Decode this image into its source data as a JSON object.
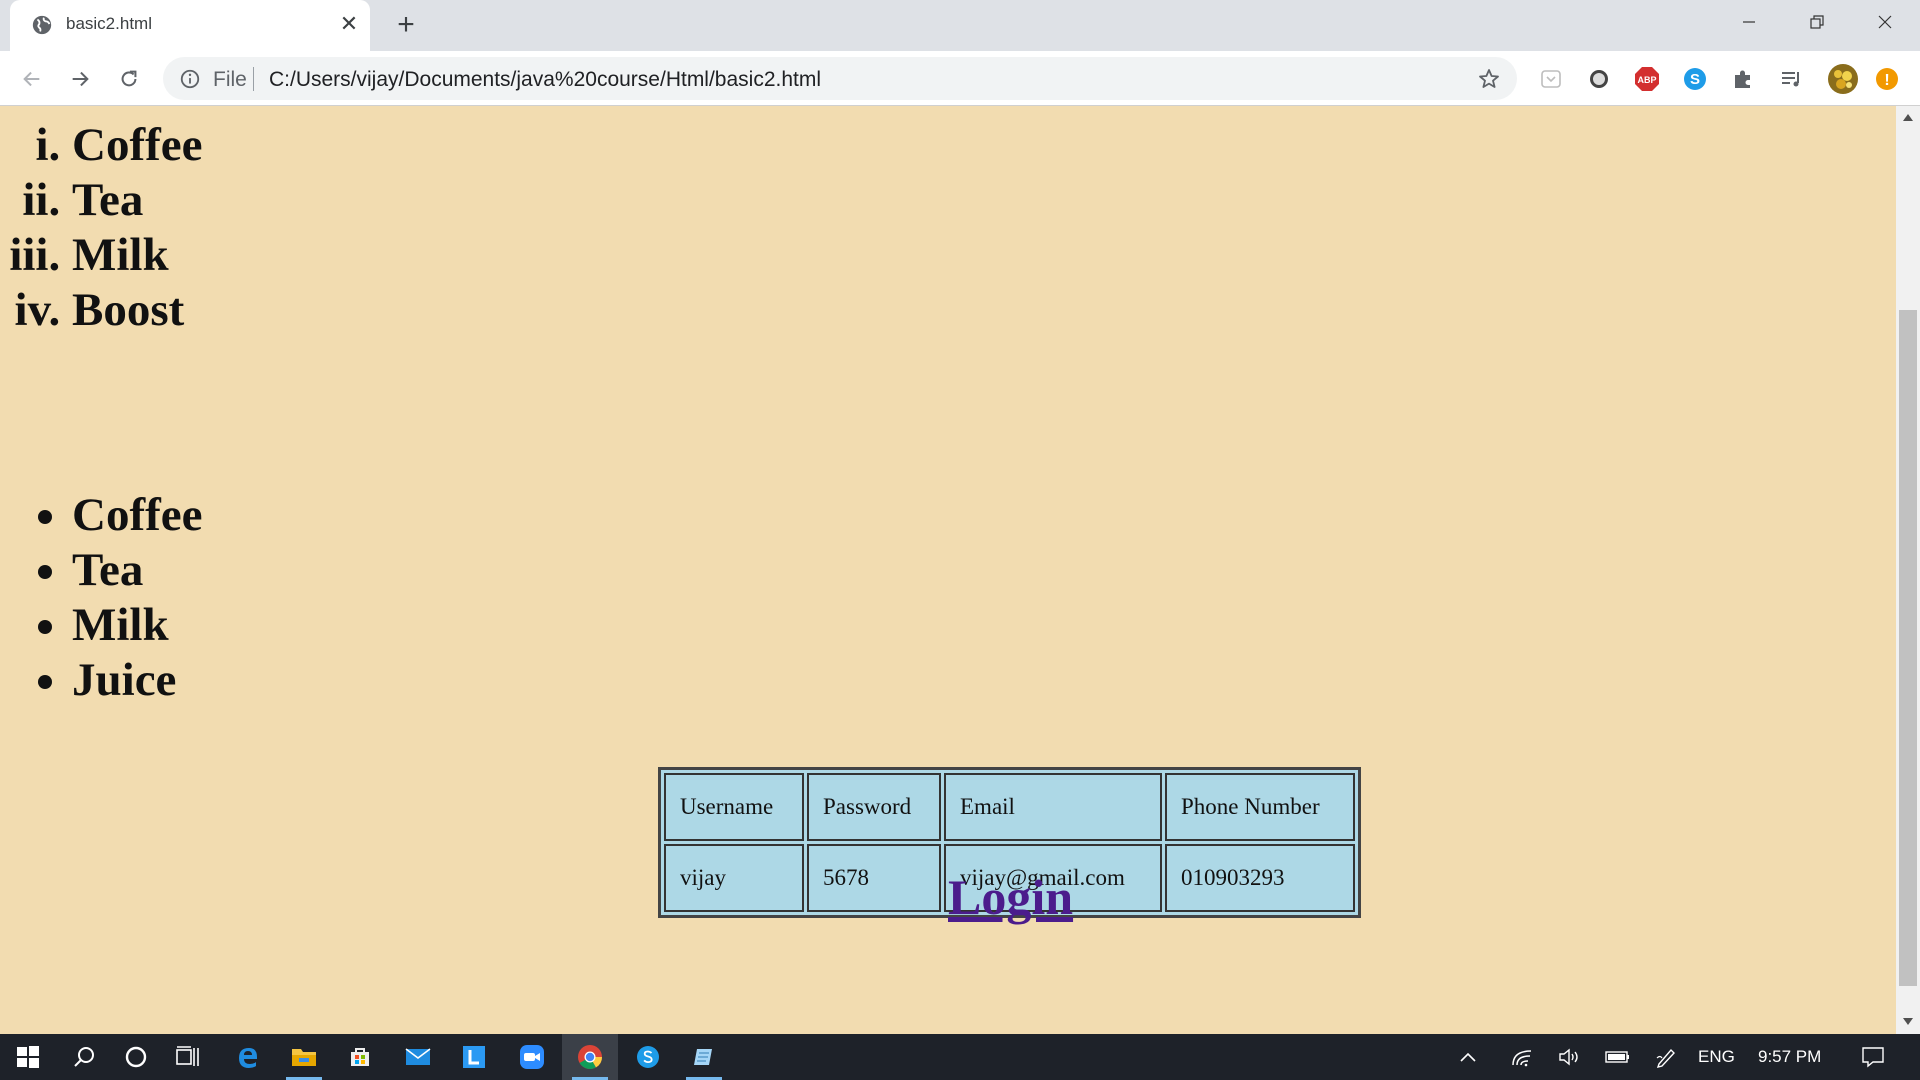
{
  "browser": {
    "tab_title": "basic2.html",
    "tab_close_glyph": "✕",
    "new_tab_glyph": "+",
    "omnibox_scheme": "File",
    "url": "C:/Users/vijay/Documents/java%20course/Html/basic2.html"
  },
  "page": {
    "ordered_list": [
      "Coffee",
      "Tea",
      "Milk",
      "Boost"
    ],
    "unordered_list": [
      "Coffee",
      "Tea",
      "Milk",
      "Juice"
    ],
    "table": {
      "headers": [
        "Username",
        "Password",
        "Email",
        "Phone Number"
      ],
      "row": [
        "vijay",
        "5678",
        "vijay@gmail.com",
        "010903293"
      ]
    },
    "login_link": "Login",
    "background_color": "#f2dcb0",
    "table_color": "#add8e6",
    "link_color": "#4b1c8c"
  },
  "extensions": {
    "abp_label": "ABP",
    "skype_label": "S",
    "alert_label": "!"
  },
  "taskbar": {
    "language": "ENG",
    "time": "9:57 PM"
  }
}
